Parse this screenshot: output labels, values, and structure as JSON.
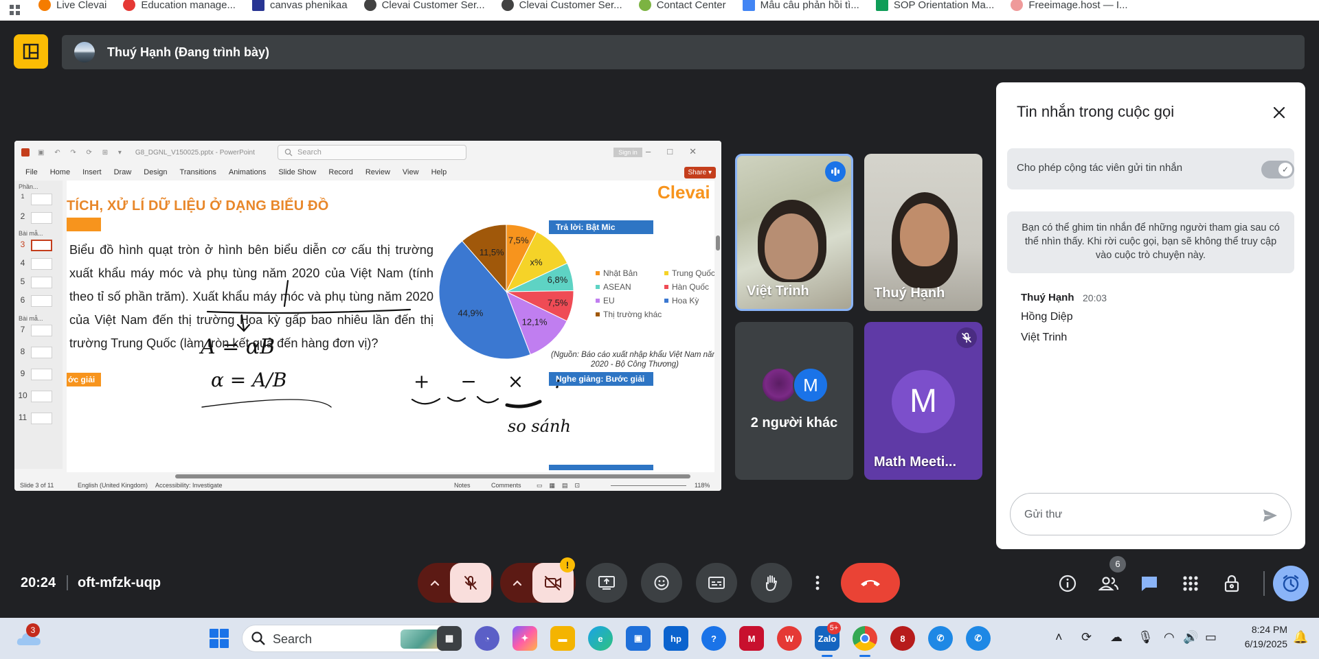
{
  "bookmarks": [
    {
      "label": "Live Clevai",
      "color": "#f57c00"
    },
    {
      "label": "Education manage...",
      "color": "#e53935"
    },
    {
      "label": "canvas phenikaa",
      "color": "#283593"
    },
    {
      "label": "Clevai Customer Ser...",
      "color": "#424242"
    },
    {
      "label": "Clevai Customer Ser...",
      "color": "#424242"
    },
    {
      "label": "Contact Center",
      "color": "#7cb342"
    },
    {
      "label": "Mẫu câu phản hồi tì...",
      "color": "#4285f4"
    },
    {
      "label": "SOP Orientation Ma...",
      "color": "#0f9d58"
    },
    {
      "label": "Freeimage.host — I...",
      "color": "#ef9a9a"
    }
  ],
  "presenter": {
    "name": "Thuý Hạnh (Đang trình bày)"
  },
  "powerpoint": {
    "file_title": "G8_DGNL_V150025.pptx - PowerPoint",
    "search_placeholder": "Search",
    "sign_in": "Sign in",
    "menu": [
      "File",
      "Home",
      "Insert",
      "Draw",
      "Design",
      "Transitions",
      "Animations",
      "Slide Show",
      "Record",
      "Review",
      "View",
      "Help"
    ],
    "share": "Share",
    "sections": [
      "Phần...",
      "Bài mẫ...",
      "Bài mẫ..."
    ],
    "slide_numbers": [
      "1",
      "2",
      "3",
      "4",
      "5",
      "6",
      "7",
      "8",
      "9",
      "10",
      "11"
    ],
    "status": {
      "slide_count": "Slide 3 of 11",
      "language": "English (United Kingdom)",
      "accessibility": "Accessibility: Investigate",
      "notes": "Notes",
      "comments": "Comments",
      "zoom": "118%"
    }
  },
  "slide": {
    "heading": "TÍCH, XỬ LÍ DỮ LIỆU Ở DẠNG BIỂU ĐỒ",
    "brand": "Clevai",
    "question": "Biểu đồ hình quạt tròn ở hình bên biểu diễn cơ cấu thị trường xuất khẩu máy móc và phụ tùng năm 2020 của Việt Nam (tính theo tỉ số phần trăm). Xuất khẩu máy móc và phụ tùng năm 2020 của Việt Nam đến thị trường Hoa kỳ gấp bao nhiêu lần đến thị trường Trung Quốc (làm tròn kết quả đến hàng đơn vị)?",
    "answer_label": "Trả lời: Bật Mic",
    "solve_label": "Nghe giảng: Bước giải",
    "steps_tag": "ớc giải",
    "source": "(Nguồn: Báo cáo xuất nhập khẩu Việt Nam năm 2020 - Bộ Công Thương)",
    "handwriting": [
      "A = αB",
      "α = A/B",
      "+ − × :",
      "so sánh"
    ]
  },
  "chart_data": {
    "type": "pie",
    "slices": [
      {
        "label": "Nhật Bản",
        "value_label": "7,5%",
        "value": 7.5,
        "color": "#f7941d"
      },
      {
        "label": "Trung Quốc",
        "value_label": "x%",
        "value": 10.7,
        "color": "#f5d328"
      },
      {
        "label": "ASEAN",
        "value_label": "6,8%",
        "value": 6.8,
        "color": "#5ed3c4"
      },
      {
        "label": "Hàn Quốc",
        "value_label": "7,5%",
        "value": 7.5,
        "color": "#ef4b55"
      },
      {
        "label": "EU",
        "value_label": "12,1%",
        "value": 12.1,
        "color": "#c07ef0"
      },
      {
        "label": "Hoa Kỳ",
        "value_label": "44,9%",
        "value": 44.9,
        "color": "#3b78d1"
      },
      {
        "label": "Thị trường khác",
        "value_label": "11,5%",
        "value": 11.5,
        "color": "#a0580a"
      }
    ],
    "legend_placement": "right"
  },
  "participants": [
    {
      "name": "Việt Trinh",
      "speaking": true
    },
    {
      "name": "Thuý Hạnh"
    },
    {
      "name": "2 người khác",
      "avatar_letter": "M"
    },
    {
      "name": "Math Meeti...",
      "avatar_letter": "M",
      "muted": true
    }
  ],
  "chat": {
    "title": "Tin nhắn trong cuộc gọi",
    "toggle_label": "Cho phép cộng tác viên gửi tin nhắn",
    "toggle_on": true,
    "info": "Bạn có thể ghim tin nhắn để những người tham gia sau có thể nhìn thấy. Khi rời cuộc gọi, bạn sẽ không thể truy cập vào cuộc trò chuyện này.",
    "messages": [
      {
        "sender": "Thuý Hạnh",
        "time": "20:03",
        "lines": [
          "Hồng Diệp",
          "Việt Trinh"
        ]
      }
    ],
    "input_placeholder": "Gửi thư"
  },
  "meeting": {
    "time": "20:24",
    "code": "oft-mfzk-uqp",
    "participant_count": "6",
    "camera_warning": "!"
  },
  "taskbar": {
    "weather_badge": "3",
    "search": "Search",
    "zalo_badge": "5+",
    "time": "8:24 PM",
    "date": "6/19/2025"
  },
  "colors": {
    "meet_bg": "#202124",
    "panel": "#3c4043",
    "end_call": "#ea4335",
    "accent_blue": "#8ab4f8",
    "clevai_orange": "#f7941d"
  }
}
